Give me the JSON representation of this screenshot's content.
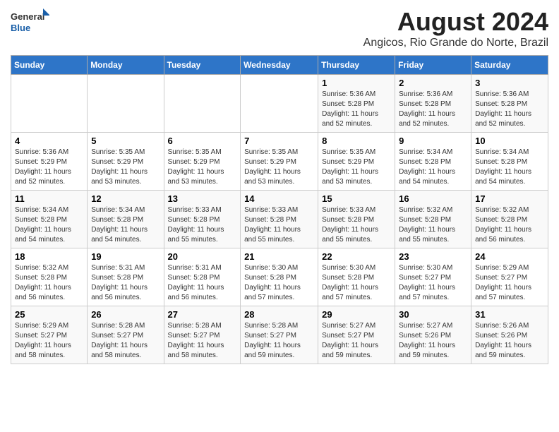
{
  "logo": {
    "general": "General",
    "blue": "Blue"
  },
  "title": "August 2024",
  "subtitle": "Angicos, Rio Grande do Norte, Brazil",
  "days_of_week": [
    "Sunday",
    "Monday",
    "Tuesday",
    "Wednesday",
    "Thursday",
    "Friday",
    "Saturday"
  ],
  "weeks": [
    [
      {
        "day": "",
        "info": ""
      },
      {
        "day": "",
        "info": ""
      },
      {
        "day": "",
        "info": ""
      },
      {
        "day": "",
        "info": ""
      },
      {
        "day": "1",
        "info": "Sunrise: 5:36 AM\nSunset: 5:28 PM\nDaylight: 11 hours and 52 minutes."
      },
      {
        "day": "2",
        "info": "Sunrise: 5:36 AM\nSunset: 5:28 PM\nDaylight: 11 hours and 52 minutes."
      },
      {
        "day": "3",
        "info": "Sunrise: 5:36 AM\nSunset: 5:28 PM\nDaylight: 11 hours and 52 minutes."
      }
    ],
    [
      {
        "day": "4",
        "info": "Sunrise: 5:36 AM\nSunset: 5:29 PM\nDaylight: 11 hours and 52 minutes."
      },
      {
        "day": "5",
        "info": "Sunrise: 5:35 AM\nSunset: 5:29 PM\nDaylight: 11 hours and 53 minutes."
      },
      {
        "day": "6",
        "info": "Sunrise: 5:35 AM\nSunset: 5:29 PM\nDaylight: 11 hours and 53 minutes."
      },
      {
        "day": "7",
        "info": "Sunrise: 5:35 AM\nSunset: 5:29 PM\nDaylight: 11 hours and 53 minutes."
      },
      {
        "day": "8",
        "info": "Sunrise: 5:35 AM\nSunset: 5:29 PM\nDaylight: 11 hours and 53 minutes."
      },
      {
        "day": "9",
        "info": "Sunrise: 5:34 AM\nSunset: 5:28 PM\nDaylight: 11 hours and 54 minutes."
      },
      {
        "day": "10",
        "info": "Sunrise: 5:34 AM\nSunset: 5:28 PM\nDaylight: 11 hours and 54 minutes."
      }
    ],
    [
      {
        "day": "11",
        "info": "Sunrise: 5:34 AM\nSunset: 5:28 PM\nDaylight: 11 hours and 54 minutes."
      },
      {
        "day": "12",
        "info": "Sunrise: 5:34 AM\nSunset: 5:28 PM\nDaylight: 11 hours and 54 minutes."
      },
      {
        "day": "13",
        "info": "Sunrise: 5:33 AM\nSunset: 5:28 PM\nDaylight: 11 hours and 55 minutes."
      },
      {
        "day": "14",
        "info": "Sunrise: 5:33 AM\nSunset: 5:28 PM\nDaylight: 11 hours and 55 minutes."
      },
      {
        "day": "15",
        "info": "Sunrise: 5:33 AM\nSunset: 5:28 PM\nDaylight: 11 hours and 55 minutes."
      },
      {
        "day": "16",
        "info": "Sunrise: 5:32 AM\nSunset: 5:28 PM\nDaylight: 11 hours and 55 minutes."
      },
      {
        "day": "17",
        "info": "Sunrise: 5:32 AM\nSunset: 5:28 PM\nDaylight: 11 hours and 56 minutes."
      }
    ],
    [
      {
        "day": "18",
        "info": "Sunrise: 5:32 AM\nSunset: 5:28 PM\nDaylight: 11 hours and 56 minutes."
      },
      {
        "day": "19",
        "info": "Sunrise: 5:31 AM\nSunset: 5:28 PM\nDaylight: 11 hours and 56 minutes."
      },
      {
        "day": "20",
        "info": "Sunrise: 5:31 AM\nSunset: 5:28 PM\nDaylight: 11 hours and 56 minutes."
      },
      {
        "day": "21",
        "info": "Sunrise: 5:30 AM\nSunset: 5:28 PM\nDaylight: 11 hours and 57 minutes."
      },
      {
        "day": "22",
        "info": "Sunrise: 5:30 AM\nSunset: 5:28 PM\nDaylight: 11 hours and 57 minutes."
      },
      {
        "day": "23",
        "info": "Sunrise: 5:30 AM\nSunset: 5:27 PM\nDaylight: 11 hours and 57 minutes."
      },
      {
        "day": "24",
        "info": "Sunrise: 5:29 AM\nSunset: 5:27 PM\nDaylight: 11 hours and 57 minutes."
      }
    ],
    [
      {
        "day": "25",
        "info": "Sunrise: 5:29 AM\nSunset: 5:27 PM\nDaylight: 11 hours and 58 minutes."
      },
      {
        "day": "26",
        "info": "Sunrise: 5:28 AM\nSunset: 5:27 PM\nDaylight: 11 hours and 58 minutes."
      },
      {
        "day": "27",
        "info": "Sunrise: 5:28 AM\nSunset: 5:27 PM\nDaylight: 11 hours and 58 minutes."
      },
      {
        "day": "28",
        "info": "Sunrise: 5:28 AM\nSunset: 5:27 PM\nDaylight: 11 hours and 59 minutes."
      },
      {
        "day": "29",
        "info": "Sunrise: 5:27 AM\nSunset: 5:27 PM\nDaylight: 11 hours and 59 minutes."
      },
      {
        "day": "30",
        "info": "Sunrise: 5:27 AM\nSunset: 5:26 PM\nDaylight: 11 hours and 59 minutes."
      },
      {
        "day": "31",
        "info": "Sunrise: 5:26 AM\nSunset: 5:26 PM\nDaylight: 11 hours and 59 minutes."
      }
    ]
  ]
}
